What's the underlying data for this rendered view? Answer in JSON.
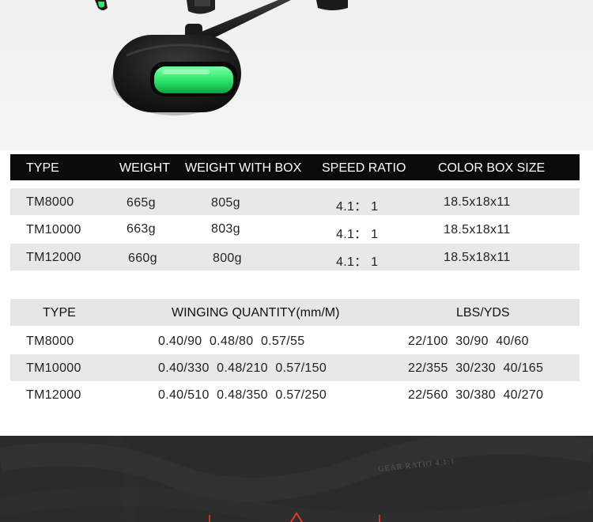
{
  "table1": {
    "headers": [
      "TYPE",
      "WEIGHT",
      "WEIGHT WITH BOX",
      "SPEED RATIO",
      "COLOR BOX SIZE"
    ],
    "rows": [
      {
        "type": "TM8000",
        "weight": "665g",
        "weight_box": "805g",
        "speed": "4.1： 1",
        "box_size": "18.5x18x11"
      },
      {
        "type": "TM10000",
        "weight": "663g",
        "weight_box": "803g",
        "speed": "4.1： 1",
        "box_size": "18.5x18x11"
      },
      {
        "type": "TM12000",
        "weight": "660g",
        "weight_box": "800g",
        "speed": "4.1： 1",
        "box_size": "18.5x18x11"
      }
    ]
  },
  "table2": {
    "headers": [
      "TYPE",
      "WINGING QUANTITY(mm/M)",
      "LBS/YDS"
    ],
    "rows": [
      {
        "type": "TM8000",
        "winging": "0.40/90  0.48/80  0.57/55",
        "lbs": "22/100  30/90  40/60"
      },
      {
        "type": "TM10000",
        "winging": "0.40/330  0.48/210  0.57/150",
        "lbs": "22/355  30/230  40/165"
      },
      {
        "type": "TM12000",
        "winging": "0.40/510  0.48/350  0.57/250",
        "lbs": "22/560  30/380  40/270"
      }
    ]
  },
  "banner": {
    "watermark_text": "GEAR RATIO 4.1:1"
  },
  "colors": {
    "accent_green": "#2ee86a",
    "header_dark": "#0b0b0b",
    "row_shade": "#e8e8e8",
    "banner_bg": "#2b2b2b"
  }
}
